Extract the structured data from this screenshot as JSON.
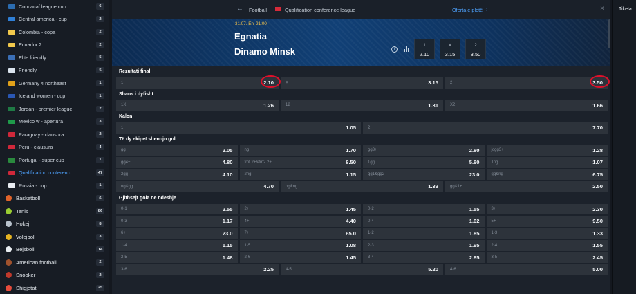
{
  "sidebar": {
    "rows": [
      {
        "type": "league",
        "name": "Concacaf league cup",
        "count": "6",
        "flag": "#2b6cb0"
      },
      {
        "type": "league",
        "name": "Central america - cup",
        "count": "2",
        "flag": "#2f7fd6"
      },
      {
        "type": "league",
        "name": "Colombia - copa",
        "count": "2",
        "flag": "#f2c94c"
      },
      {
        "type": "league",
        "name": "Ecuador 2",
        "count": "2",
        "flag": "#f2c94c"
      },
      {
        "type": "league",
        "name": "Elite friendly",
        "count": "5",
        "flag": "#3b6fb6"
      },
      {
        "type": "league",
        "name": "Friendly",
        "count": "5",
        "flag": "#dbe4ee"
      },
      {
        "type": "league",
        "name": "Germany 4 northeast",
        "count": "1",
        "flag": "#e0a11a"
      },
      {
        "type": "league",
        "name": "Iceland women - cup",
        "count": "1",
        "flag": "#2a57b3"
      },
      {
        "type": "league",
        "name": "Jordan - premier league",
        "count": "2",
        "flag": "#1f7a45"
      },
      {
        "type": "league",
        "name": "Mexico w - apertura",
        "count": "3",
        "flag": "#1f9a4a"
      },
      {
        "type": "league",
        "name": "Paraguay - clausura",
        "count": "2",
        "flag": "#d0283a"
      },
      {
        "type": "league",
        "name": "Peru - clausura",
        "count": "4",
        "flag": "#d0283a"
      },
      {
        "type": "league",
        "name": "Portugal - super cup",
        "count": "1",
        "flag": "#2a8a3e"
      },
      {
        "type": "league",
        "name": "Qualification conferenc...",
        "count": "47",
        "flag": "#d0283a",
        "active": true
      },
      {
        "type": "league",
        "name": "Russia - cup",
        "count": "1",
        "flag": "#e8ecf1"
      },
      {
        "type": "sport",
        "name": "Basketboll",
        "count": "6",
        "icon": "#e0632a"
      },
      {
        "type": "sport",
        "name": "Tenis",
        "count": "86",
        "icon": "#9acd32"
      },
      {
        "type": "sport",
        "name": "Hokej",
        "count": "8",
        "icon": "#b8c2cc"
      },
      {
        "type": "sport",
        "name": "Volejboll",
        "count": "3",
        "icon": "#e6b422"
      },
      {
        "type": "sport",
        "name": "Bejsboll",
        "count": "14",
        "icon": "#e9edf1"
      },
      {
        "type": "sport",
        "name": "American football",
        "count": "2",
        "icon": "#a0522d"
      },
      {
        "type": "sport",
        "name": "Snooker",
        "count": "2",
        "icon": "#c0392b"
      },
      {
        "type": "sport",
        "name": "Shigjetat",
        "count": "25",
        "icon": "#e74c3c"
      }
    ]
  },
  "topbar": {
    "back_icon": "arrow-left-icon",
    "crumb": "Football",
    "league": "Qualification conference league",
    "more": "Oferta e plotë ⋮",
    "close": "×"
  },
  "match": {
    "date": "31.07. Enj 21:00",
    "team1": "Egnatia",
    "team2": "Dinamo Minsk",
    "odds": [
      {
        "label": "1",
        "value": "2.10"
      },
      {
        "label": "X",
        "value": "3.15"
      },
      {
        "label": "2",
        "value": "3.50"
      }
    ]
  },
  "markets": [
    {
      "title": "Rezultati final",
      "rows": [
        [
          {
            "label": "1",
            "value": "2.10",
            "ring": true
          },
          {
            "label": "X",
            "value": "3.15"
          },
          {
            "label": "2",
            "value": "3.50",
            "ring": true
          }
        ]
      ]
    },
    {
      "title": "Shans i dyfisht",
      "rows": [
        [
          {
            "label": "1X",
            "value": "1.26"
          },
          {
            "label": "12",
            "value": "1.31"
          },
          {
            "label": "X2",
            "value": "1.66"
          }
        ]
      ]
    },
    {
      "title": "Kalon",
      "rows": [
        [
          {
            "label": "1",
            "value": "1.05"
          },
          {
            "label": "2",
            "value": "7.70"
          }
        ]
      ]
    },
    {
      "title": "Të dy ekipet shenojn gol",
      "rows": [
        [
          {
            "label": "gg",
            "value": "2.05"
          },
          {
            "label": "ng",
            "value": "1.70"
          },
          {
            "label": "gg3+",
            "value": "2.80"
          },
          {
            "label": "jogg3+",
            "value": "1.28"
          }
        ],
        [
          {
            "label": "gg4+",
            "value": "4.80"
          },
          {
            "label": "tmt 2+&tm2 2+",
            "value": "8.50"
          },
          {
            "label": "1gg",
            "value": "5.60"
          },
          {
            "label": "1ng",
            "value": "1.07"
          }
        ],
        [
          {
            "label": "2gg",
            "value": "4.10"
          },
          {
            "label": "2ng",
            "value": "1.15"
          },
          {
            "label": "gg1&gg2",
            "value": "23.0"
          },
          {
            "label": "gg&ng",
            "value": "6.75"
          }
        ],
        [
          {
            "label": "ng&gg",
            "value": "4.70"
          },
          {
            "label": "ng&ng",
            "value": "1.33"
          },
          {
            "label": "gg&1+",
            "value": "2.50"
          }
        ]
      ]
    },
    {
      "title": "Gjithsejt gola në ndeshje",
      "rows": [
        [
          {
            "label": "0-1",
            "value": "2.55"
          },
          {
            "label": "2+",
            "value": "1.45"
          },
          {
            "label": "0-2",
            "value": "1.55"
          },
          {
            "label": "3+",
            "value": "2.30"
          }
        ],
        [
          {
            "label": "0-3",
            "value": "1.17"
          },
          {
            "label": "4+",
            "value": "4.40"
          },
          {
            "label": "0-4",
            "value": "1.02"
          },
          {
            "label": "5+",
            "value": "9.50"
          }
        ],
        [
          {
            "label": "6+",
            "value": "23.0"
          },
          {
            "label": "7+",
            "value": "65.0"
          },
          {
            "label": "1-2",
            "value": "1.85"
          },
          {
            "label": "1-3",
            "value": "1.33"
          }
        ],
        [
          {
            "label": "1-4",
            "value": "1.15"
          },
          {
            "label": "1-5",
            "value": "1.08"
          },
          {
            "label": "2-3",
            "value": "1.95"
          },
          {
            "label": "2-4",
            "value": "1.55"
          }
        ],
        [
          {
            "label": "2-5",
            "value": "1.48"
          },
          {
            "label": "2-6",
            "value": "1.45"
          },
          {
            "label": "3-4",
            "value": "2.85"
          },
          {
            "label": "3-5",
            "value": "2.45"
          }
        ],
        [
          {
            "label": "3-6",
            "value": "2.25"
          },
          {
            "label": "4-5",
            "value": "5.20"
          },
          {
            "label": "4-6",
            "value": "5.00"
          }
        ]
      ]
    }
  ],
  "tiketa": "Tiketa"
}
